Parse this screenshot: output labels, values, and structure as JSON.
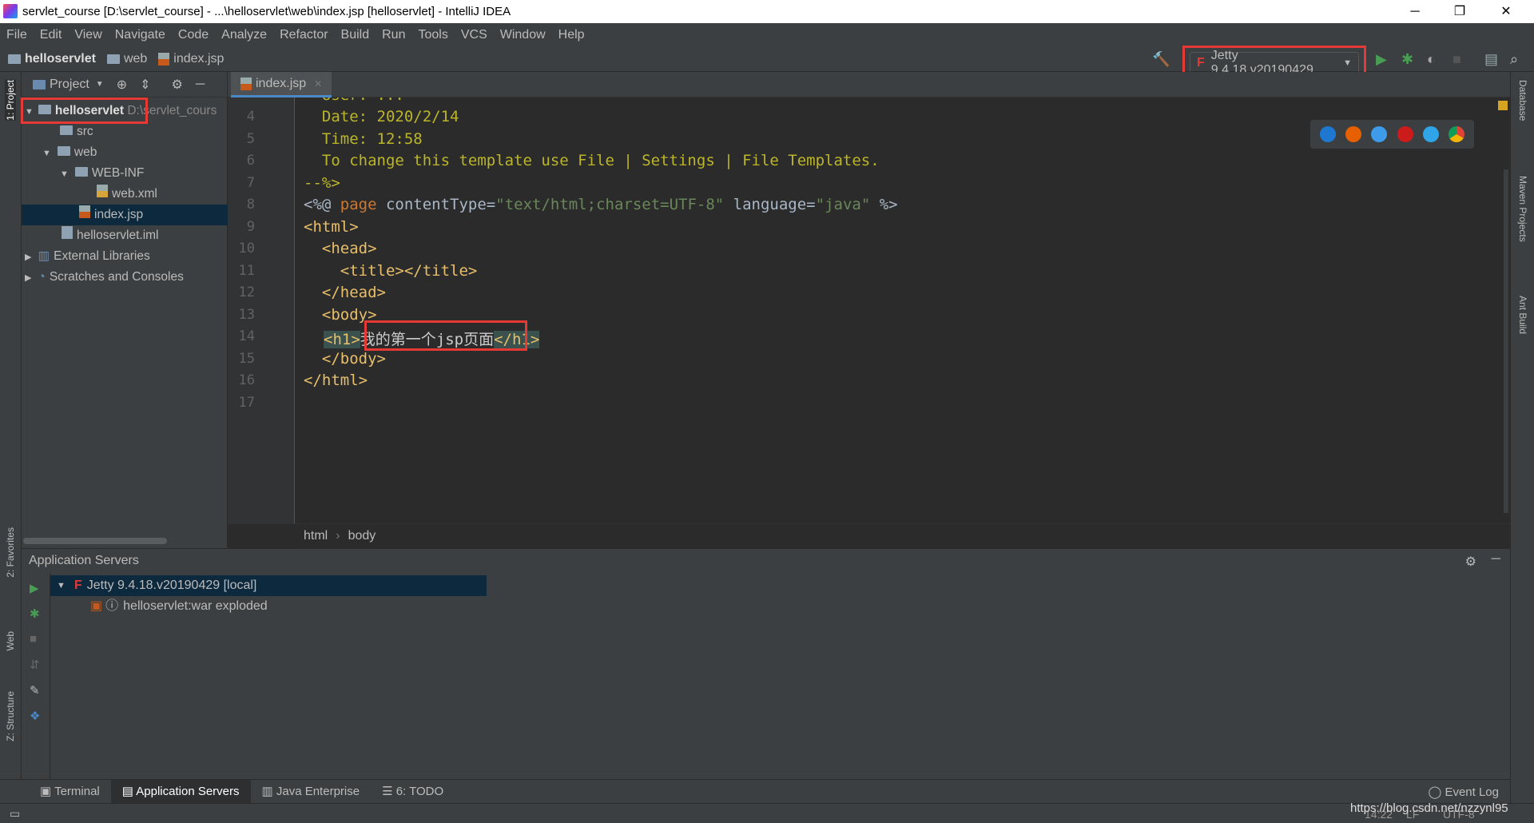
{
  "window": {
    "title": "servlet_course [D:\\servlet_course] - ...\\helloservlet\\web\\index.jsp [helloservlet] - IntelliJ IDEA",
    "minimize": "─",
    "restore": "❐",
    "close": "✕"
  },
  "menu": [
    "File",
    "Edit",
    "View",
    "Navigate",
    "Code",
    "Analyze",
    "Refactor",
    "Build",
    "Run",
    "Tools",
    "VCS",
    "Window",
    "Help"
  ],
  "breadcrumb": [
    "helloservlet",
    "web",
    "index.jsp"
  ],
  "toolbar": {
    "run_config": "Jetty 9.4.18.v20190429"
  },
  "left_strip": {
    "project": "1: Project",
    "favorites": "2: Favorites",
    "web": "Web",
    "structure": "Z: Structure"
  },
  "right_strip": {
    "database": "Database",
    "maven": "Maven Projects",
    "ant": "Ant Build"
  },
  "project": {
    "header": "Project",
    "tree": [
      {
        "label": "helloservlet",
        "extra": "D:\\servlet_cours",
        "depth": 0,
        "expanded": true
      },
      {
        "label": "src",
        "depth": 1
      },
      {
        "label": "web",
        "depth": 1,
        "expanded": true
      },
      {
        "label": "WEB-INF",
        "depth": 2,
        "expanded": true
      },
      {
        "label": "web.xml",
        "depth": 3
      },
      {
        "label": "index.jsp",
        "depth": 2,
        "selected": true
      },
      {
        "label": "helloservlet.iml",
        "depth": 1
      },
      {
        "label": "External Libraries",
        "depth": 0,
        "collapsed": true
      },
      {
        "label": "Scratches and Consoles",
        "depth": 0,
        "collapsed": true
      }
    ]
  },
  "editor": {
    "tab": "index.jsp",
    "line_numbers": [
      "4",
      "5",
      "6",
      "7",
      "8",
      "9",
      "10",
      "11",
      "12",
      "13",
      "14",
      "15",
      "16",
      "17"
    ],
    "lines": {
      "l4": "  Date: 2020/2/14",
      "l5": "  Time: 12:58",
      "l6": "  To change this template use File | Settings | File Templates.",
      "l7": "--%>",
      "l8a": "<%@ ",
      "l8b": "page ",
      "l8c": "contentType=",
      "l8d": "\"text/html;charset=UTF-8\"",
      "l8e": " language=",
      "l8f": "\"java\"",
      "l8g": " %>",
      "l9": "<html>",
      "l10": "  <head>",
      "l11": "    <title></title>",
      "l12": "  </head>",
      "l13": "  <body>",
      "l14a": "<h1>",
      "l14b": "我的第一个jsp页面",
      "l14c": "</h1>",
      "l15": "  </body>",
      "l16": "</html>"
    },
    "breadcrumb": [
      "html",
      "body"
    ]
  },
  "servers": {
    "title": "Application Servers",
    "server": "Jetty 9.4.18.v20190429 [local]",
    "artifact": "helloservlet:war exploded"
  },
  "bottom_tabs": [
    "Terminal",
    "Application Servers",
    "Java Enterprise",
    "6: TODO"
  ],
  "event_log": "Event Log",
  "status": {
    "position": "14:22",
    "line_sep": "LF",
    "encoding": "UTF-8",
    "watermark": "https://blog.csdn.net/nzzynl95"
  }
}
